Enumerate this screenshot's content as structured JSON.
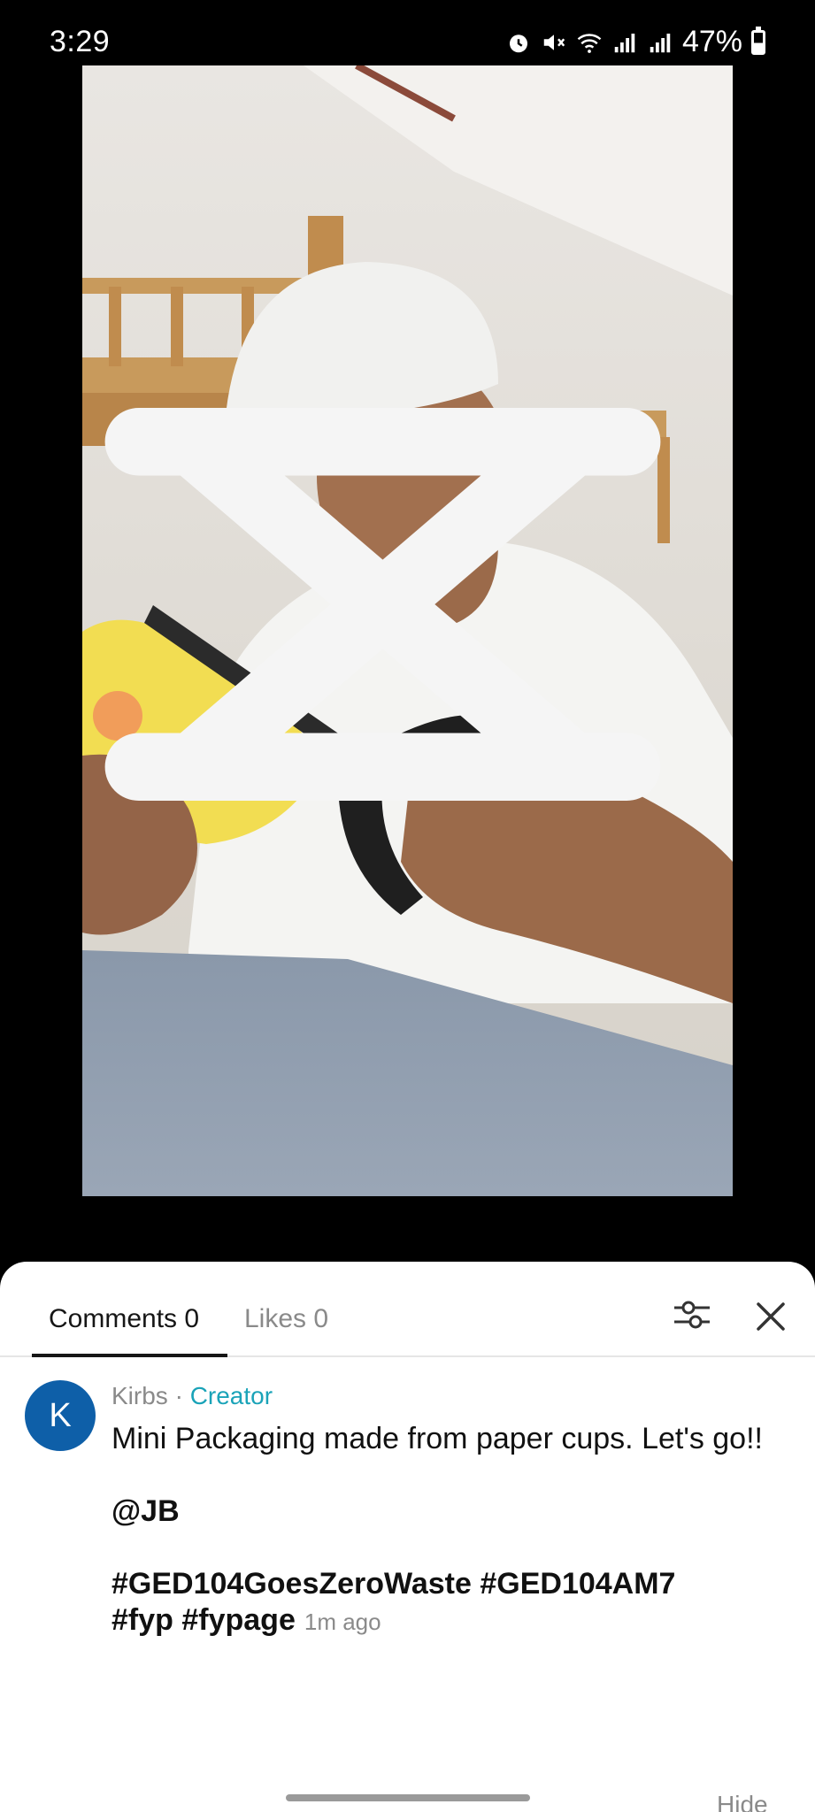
{
  "status_bar": {
    "time": "3:29",
    "battery": "47%",
    "icons": [
      "alarm-icon",
      "mute-icon",
      "wifi-icon",
      "signal-icon",
      "signal-icon",
      "battery-icon"
    ]
  },
  "video": {
    "watermark_icon": "capcut-icon"
  },
  "comments_sheet": {
    "tabs": [
      {
        "label": "Comments 0"
      },
      {
        "label": "Likes 0"
      }
    ],
    "comment": {
      "avatar_letter": "K",
      "author": "Kirbs",
      "separator": "·",
      "badge": "Creator",
      "text_line1": "Mini Packaging made from paper cups. Let's go!!",
      "mention": "@JB",
      "hashtags_line1": "#GED104GoesZeroWaste #GED104AM7",
      "hashtags_line2": "#fyp #fypage",
      "time": "1m ago"
    },
    "hide_label": "Hide"
  },
  "colors": {
    "accent": "#1aa3b8",
    "avatar": "#0e5fa8"
  }
}
